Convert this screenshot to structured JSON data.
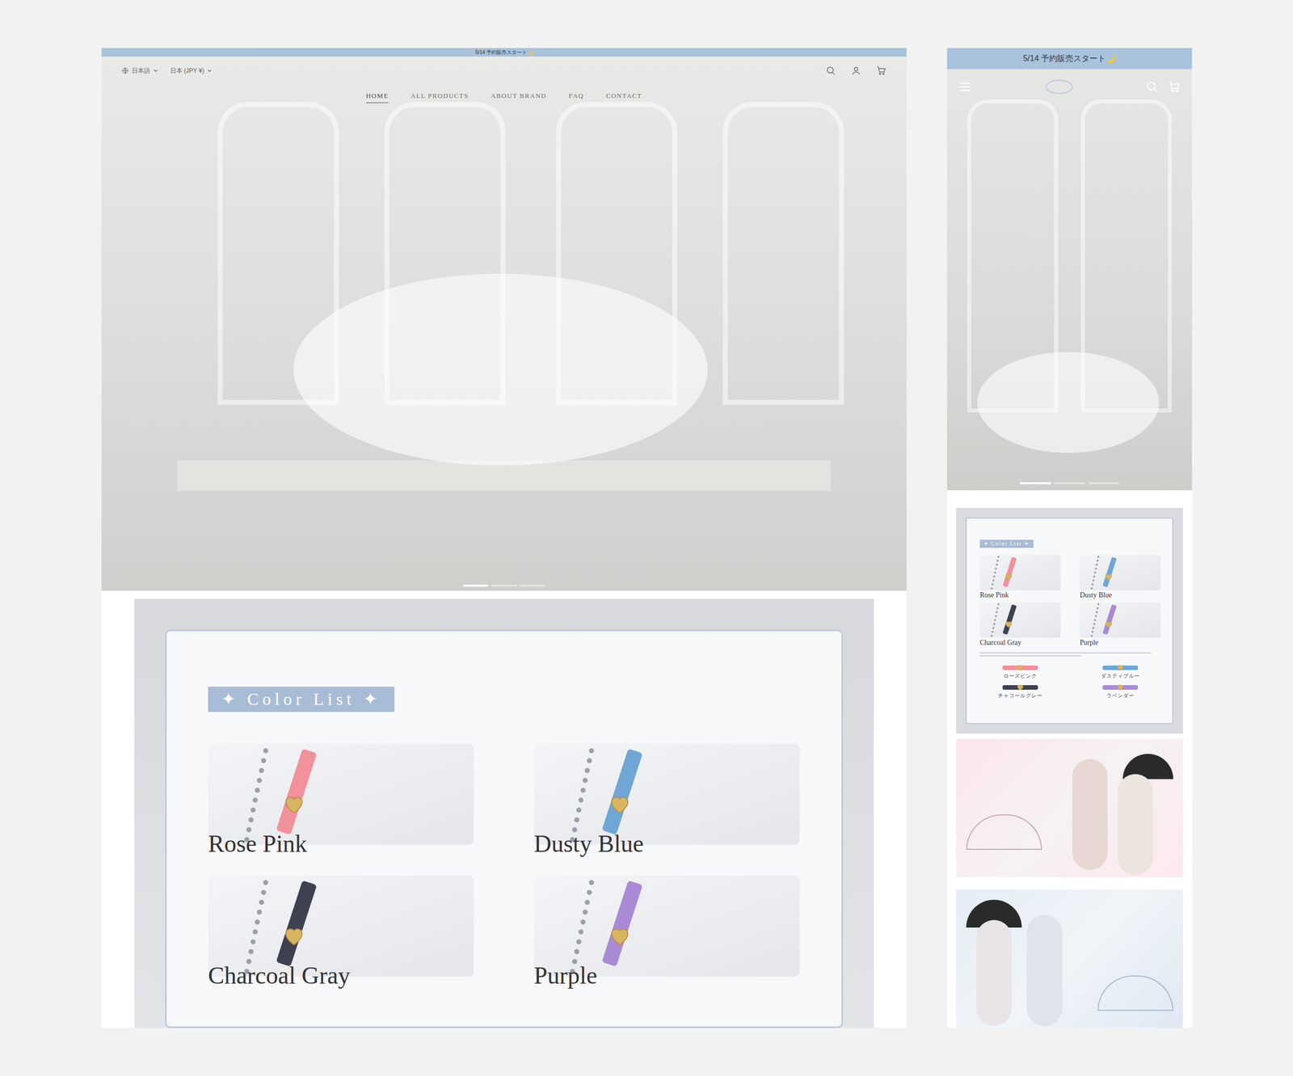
{
  "desktop": {
    "announcement": "5/14 予約販売スタート🌙",
    "language": "日本語",
    "currency": "日本 (JPY ¥)",
    "nav": [
      {
        "label": "HOME",
        "selected": true
      },
      {
        "label": "ALL PRODUCTS",
        "selected": false
      },
      {
        "label": "ABOUT BRAND",
        "selected": false
      },
      {
        "label": "FAQ",
        "selected": false
      },
      {
        "label": "CONTACT",
        "selected": false
      }
    ],
    "slides": [
      {
        "selected": true
      },
      {
        "selected": false
      },
      {
        "selected": false
      }
    ],
    "color_list": {
      "title": "✦ Color List ✦",
      "colors": [
        {
          "name": "Rose Pink",
          "color": "#f2909c"
        },
        {
          "name": "Dusty Blue",
          "color": "#6fa6d6"
        },
        {
          "name": "Charcoal Gray",
          "color": "#3d4150"
        },
        {
          "name": "Purple",
          "color": "#a98ad6"
        }
      ]
    }
  },
  "mobile": {
    "announcement": "5/14 予約販売スタート🌙",
    "slides": [
      {
        "selected": true
      },
      {
        "selected": false
      },
      {
        "selected": false
      }
    ],
    "color_list": {
      "title": "✦ Color List ✦",
      "colors": [
        {
          "name": "Rose Pink",
          "label": "ローズピンク",
          "color": "#f2909c"
        },
        {
          "name": "Dusty Blue",
          "label": "ダスティブルー",
          "color": "#6fa6d6"
        },
        {
          "name": "Charcoal Gray",
          "label": "チャコールグレー",
          "color": "#3d4150"
        },
        {
          "name": "Purple",
          "label": "ラベンダー",
          "color": "#a98ad6"
        }
      ]
    }
  }
}
